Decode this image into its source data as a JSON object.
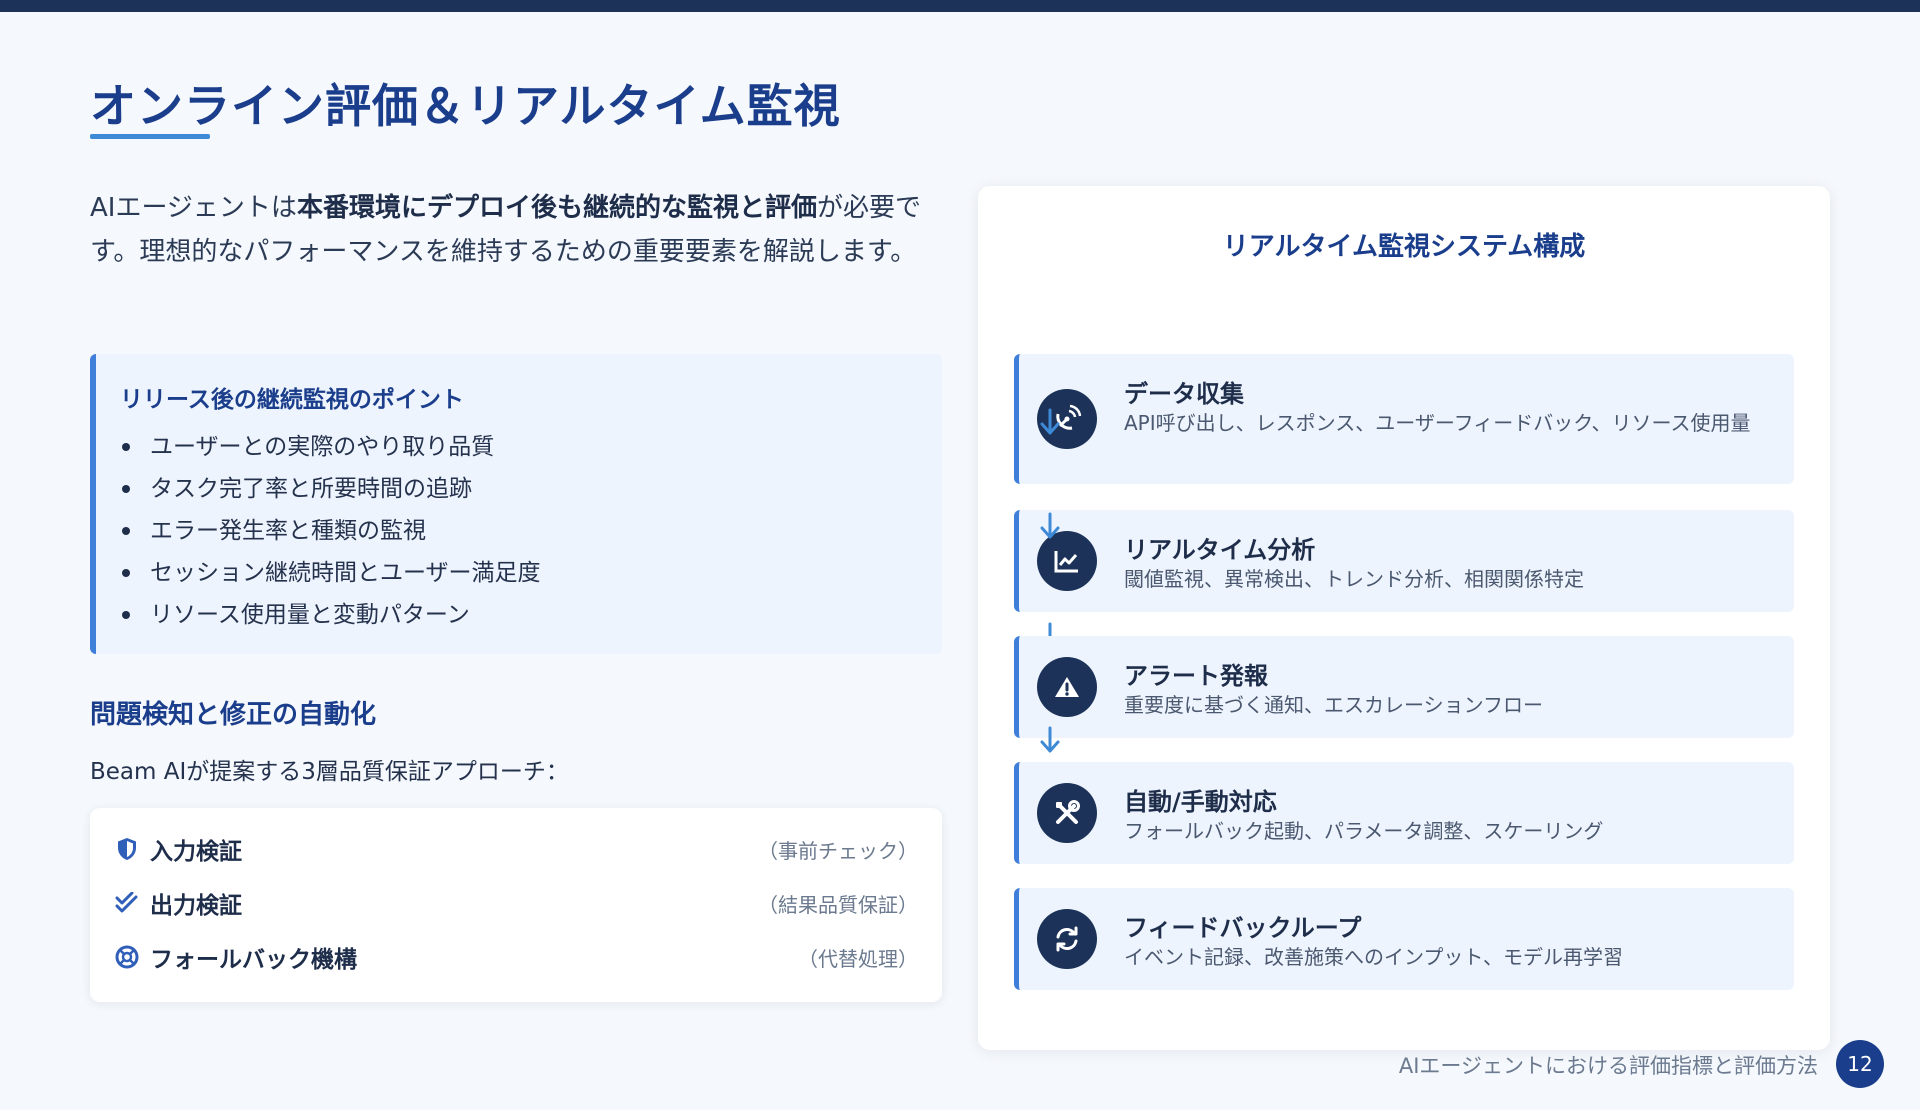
{
  "slide": {
    "title": "オンライン評価＆リアルタイム監視",
    "intro": {
      "part1": "AIエージェントは",
      "bold": "本番環境にデプロイ後も継続的な監視と評価",
      "part2": "が必要です。理想的なパフォーマンスを維持するための重要要素を解説します。"
    }
  },
  "points": {
    "title": "リリース後の継続監視のポイント",
    "items": [
      "ユーザーとの実際のやり取り品質",
      "タスク完了率と所要時間の追跡",
      "エラー発生率と種類の監視",
      "セッション継続時間とユーザー満足度",
      "リソース使用量と変動パターン"
    ]
  },
  "automation": {
    "heading": "問題検知と修正の自動化",
    "sub": "Beam AIが提案する3層品質保証アプローチ：",
    "items": [
      {
        "label": "入力検証",
        "note": "（事前チェック）",
        "icon": "shield-icon"
      },
      {
        "label": "出力検証",
        "note": "（結果品質保証）",
        "icon": "double-check-icon"
      },
      {
        "label": "フォールバック機構",
        "note": "（代替処理）",
        "icon": "lifebuoy-icon"
      }
    ]
  },
  "monitor": {
    "title": "リアルタイム監視システム構成",
    "steps": [
      {
        "title": "データ収集",
        "desc": "API呼び出し、レスポンス、ユーザーフィードバック、リソース使用量",
        "icon": "satellite-dish-icon"
      },
      {
        "title": "リアルタイム分析",
        "desc": "閾値監視、異常検出、トレンド分析、相関関係特定",
        "icon": "line-chart-icon"
      },
      {
        "title": "アラート発報",
        "desc": "重要度に基づく通知、エスカレーションフロー",
        "icon": "warning-icon"
      },
      {
        "title": "自動/手動対応",
        "desc": "フォールバック起動、パラメータ調整、スケーリング",
        "icon": "tools-icon"
      },
      {
        "title": "フィードバックループ",
        "desc": "イベント記録、改善施策へのインプット、モデル再学習",
        "icon": "sync-icon"
      }
    ]
  },
  "footer": {
    "text": "AIエージェントにおける評価指標と評価方法",
    "page": "12"
  },
  "colors": {
    "navy": "#1c3259",
    "title_blue": "#1b3e8c",
    "accent_blue": "#3f7fd9",
    "panel_bg": "#eef4fd",
    "page_bg": "#f5f8fc"
  }
}
